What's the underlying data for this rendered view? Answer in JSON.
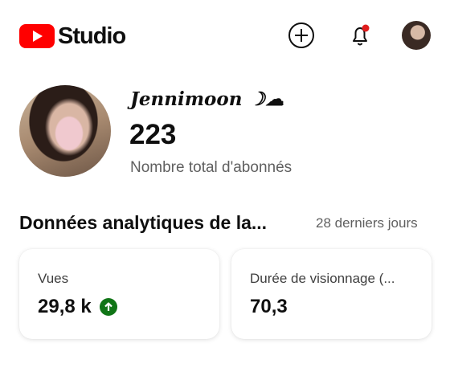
{
  "header": {
    "logo_text": "Studio",
    "brand_color": "#ff0000",
    "create_icon": "create-plus-icon",
    "bell_icon": "notifications-bell-icon",
    "notification_dot_color": "#e01e1e"
  },
  "channel": {
    "name": "Jennimoon ☽☁",
    "subscriber_count": "223",
    "subscriber_label": "Nombre total d'abonnés"
  },
  "analytics": {
    "title": "Données analytiques de la...",
    "period": "28 derniers jours",
    "cards": [
      {
        "label": "Vues",
        "value": "29,8 k",
        "trend": "up",
        "trend_color": "#107516"
      },
      {
        "label": "Durée de visionnage (...",
        "value": "70,3"
      }
    ]
  }
}
